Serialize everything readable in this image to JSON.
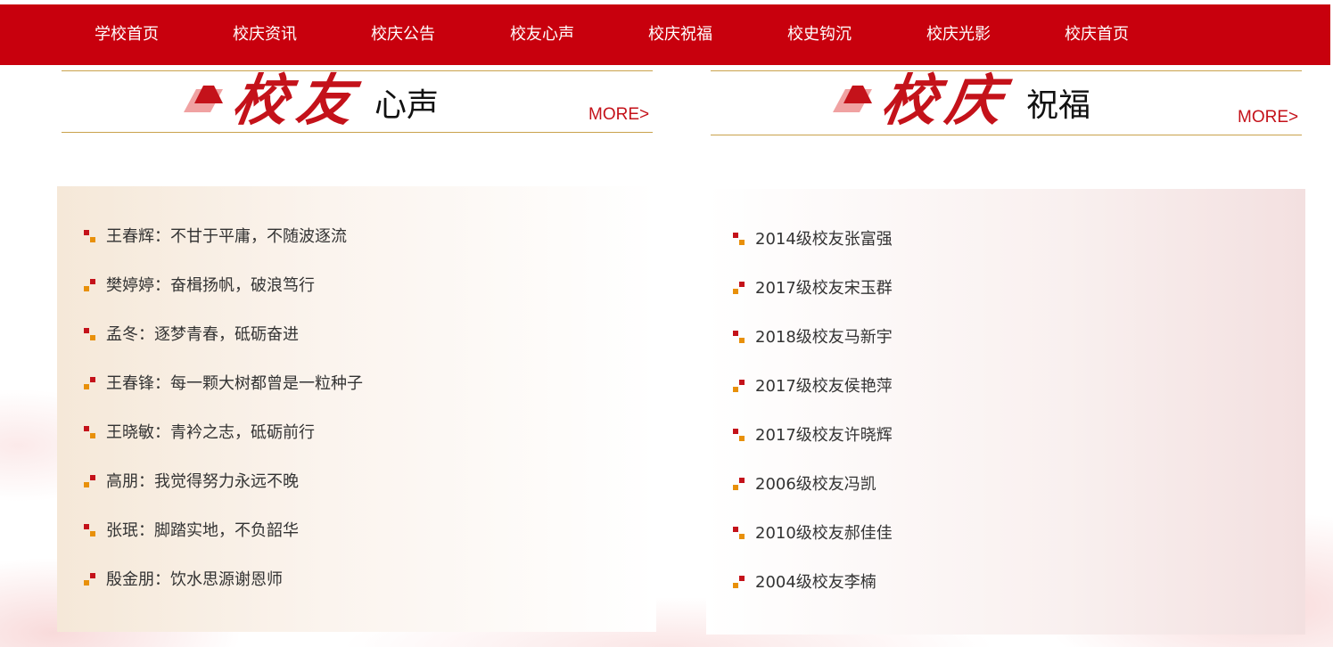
{
  "nav": {
    "items": [
      {
        "label": "学校首页"
      },
      {
        "label": "校庆资讯"
      },
      {
        "label": "校庆公告"
      },
      {
        "label": "校友心声"
      },
      {
        "label": "校庆祝福"
      },
      {
        "label": "校史钩沉"
      },
      {
        "label": "校庆光影"
      },
      {
        "label": "校庆首页"
      }
    ]
  },
  "left_panel": {
    "title_big": "校友",
    "title_small": "心声",
    "more": "MORE>",
    "items": [
      {
        "text": "王春辉：不甘于平庸，不随波逐流"
      },
      {
        "text": "樊婷婷：奋楫扬帆，破浪笃行"
      },
      {
        "text": "孟冬：逐梦青春，砥砺奋进"
      },
      {
        "text": "王春锋：每一颗大树都曾是一粒种子"
      },
      {
        "text": "王晓敏：青衿之志，砥砺前行"
      },
      {
        "text": "高朋：我觉得努力永远不晚"
      },
      {
        "text": "张珉：脚踏实地，不负韶华"
      },
      {
        "text": "殷金朋：饮水思源谢恩师"
      }
    ]
  },
  "right_panel": {
    "title_big": "校庆",
    "title_small": "祝福",
    "more": "MORE>",
    "items": [
      {
        "text": "2014级校友张富强"
      },
      {
        "text": "2017级校友宋玉群"
      },
      {
        "text": "2018级校友马新宇"
      },
      {
        "text": "2017级校友侯艳萍"
      },
      {
        "text": "2017级校友许晓辉"
      },
      {
        "text": "2006级校友冯凯"
      },
      {
        "text": "2010级校友郝佳佳"
      },
      {
        "text": "2004级校友李楠"
      }
    ]
  },
  "colors": {
    "nav_bg": "#c8000d",
    "accent_red": "#c4121a",
    "accent_orange": "#e8900a",
    "rule_gold": "#c9a24c"
  }
}
